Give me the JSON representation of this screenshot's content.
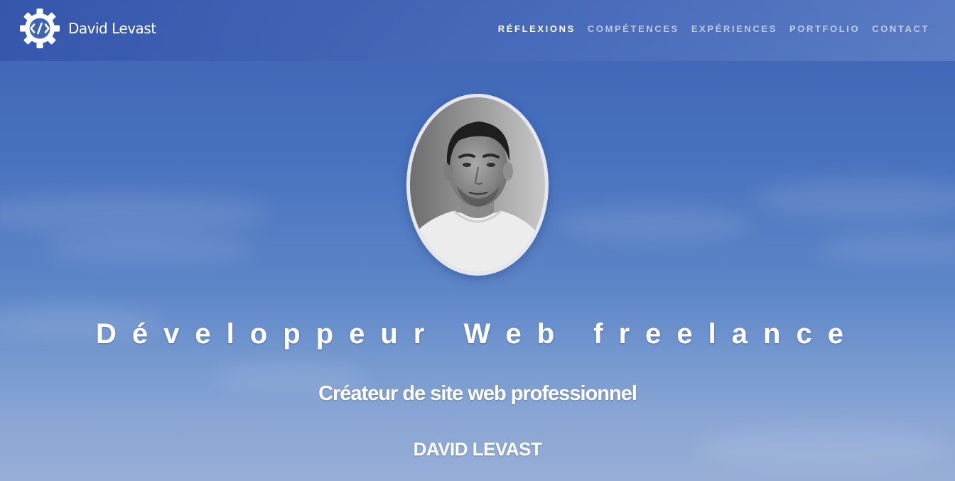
{
  "brand": {
    "name": "David Levast",
    "logo_icon": "gear-code-icon"
  },
  "nav": {
    "items": [
      {
        "label": "RÉFLEXIONS",
        "active": true
      },
      {
        "label": "COMPÉTENCES",
        "active": false
      },
      {
        "label": "EXPÉRIENCES",
        "active": false
      },
      {
        "label": "PORTFOLIO",
        "active": false
      },
      {
        "label": "CONTACT",
        "active": false
      }
    ]
  },
  "hero": {
    "headline": "Développeur Web freelance",
    "subtitle": "Créateur de site web professionnel",
    "name": "DAVID LEVAST",
    "avatar_alt": "portrait-photo"
  },
  "colors": {
    "sky_top": "#3f63b5",
    "sky_bottom": "#98aed6",
    "text": "#ffffff",
    "nav_inactive": "rgba(255,255,255,0.62)"
  }
}
